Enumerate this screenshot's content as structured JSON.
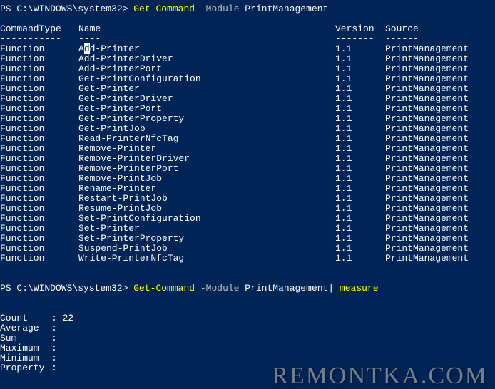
{
  "prompt1": {
    "path": "PS C:\\WINDOWS\\system32> ",
    "cmdlet": "Get-Command",
    "param": " -Module ",
    "arg": "PrintManagement"
  },
  "headers": {
    "type": "CommandType",
    "name": "Name",
    "version": "Version",
    "source": "Source"
  },
  "underlines": {
    "type": "-----------",
    "name": "----",
    "version": "-------",
    "source": "------"
  },
  "rows": [
    {
      "type": "Function",
      "name": "Add-Printer",
      "version": "1.1",
      "source": "PrintManagement"
    },
    {
      "type": "Function",
      "name": "Add-PrinterDriver",
      "version": "1.1",
      "source": "PrintManagement"
    },
    {
      "type": "Function",
      "name": "Add-PrinterPort",
      "version": "1.1",
      "source": "PrintManagement"
    },
    {
      "type": "Function",
      "name": "Get-PrintConfiguration",
      "version": "1.1",
      "source": "PrintManagement"
    },
    {
      "type": "Function",
      "name": "Get-Printer",
      "version": "1.1",
      "source": "PrintManagement"
    },
    {
      "type": "Function",
      "name": "Get-PrinterDriver",
      "version": "1.1",
      "source": "PrintManagement"
    },
    {
      "type": "Function",
      "name": "Get-PrinterPort",
      "version": "1.1",
      "source": "PrintManagement"
    },
    {
      "type": "Function",
      "name": "Get-PrinterProperty",
      "version": "1.1",
      "source": "PrintManagement"
    },
    {
      "type": "Function",
      "name": "Get-PrintJob",
      "version": "1.1",
      "source": "PrintManagement"
    },
    {
      "type": "Function",
      "name": "Read-PrinterNfcTag",
      "version": "1.1",
      "source": "PrintManagement"
    },
    {
      "type": "Function",
      "name": "Remove-Printer",
      "version": "1.1",
      "source": "PrintManagement"
    },
    {
      "type": "Function",
      "name": "Remove-PrinterDriver",
      "version": "1.1",
      "source": "PrintManagement"
    },
    {
      "type": "Function",
      "name": "Remove-PrinterPort",
      "version": "1.1",
      "source": "PrintManagement"
    },
    {
      "type": "Function",
      "name": "Remove-PrintJob",
      "version": "1.1",
      "source": "PrintManagement"
    },
    {
      "type": "Function",
      "name": "Rename-Printer",
      "version": "1.1",
      "source": "PrintManagement"
    },
    {
      "type": "Function",
      "name": "Restart-PrintJob",
      "version": "1.1",
      "source": "PrintManagement"
    },
    {
      "type": "Function",
      "name": "Resume-PrintJob",
      "version": "1.1",
      "source": "PrintManagement"
    },
    {
      "type": "Function",
      "name": "Set-PrintConfiguration",
      "version": "1.1",
      "source": "PrintManagement"
    },
    {
      "type": "Function",
      "name": "Set-Printer",
      "version": "1.1",
      "source": "PrintManagement"
    },
    {
      "type": "Function",
      "name": "Set-PrinterProperty",
      "version": "1.1",
      "source": "PrintManagement"
    },
    {
      "type": "Function",
      "name": "Suspend-PrintJob",
      "version": "1.1",
      "source": "PrintManagement"
    },
    {
      "type": "Function",
      "name": "Write-PrinterNfcTag",
      "version": "1.1",
      "source": "PrintManagement"
    }
  ],
  "prompt2": {
    "path": "PS C:\\WINDOWS\\system32> ",
    "cmdlet": "Get-Command",
    "param": " -Module ",
    "arg": "PrintManagement",
    "pipe": "| ",
    "cmdlet2": "measure"
  },
  "measure": {
    "count_label": "Count",
    "count_value": "22",
    "avg_label": "Average",
    "sum_label": "Sum",
    "max_label": "Maximum",
    "min_label": "Minimum",
    "prop_label": "Property"
  },
  "watermark": "REMONTKA.COM",
  "cursor_char_before": "A",
  "cursor_char": "d",
  "cursor_char_after": "d-Printer"
}
